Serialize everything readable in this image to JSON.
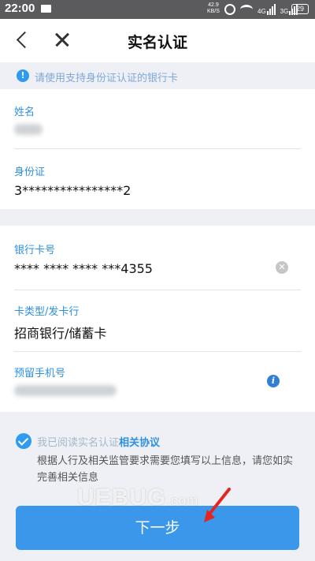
{
  "status_bar": {
    "time": "22:00",
    "net_speed": "42.9",
    "net_unit": "KB/S",
    "signal1_label": "4G",
    "signal2_label": "3G",
    "battery": "29"
  },
  "header": {
    "title": "实名认证"
  },
  "notice": {
    "icon": "!",
    "text": "请使用支持身份证认证的银行卡"
  },
  "identity": {
    "name_label": "姓名",
    "id_label": "身份证",
    "id_value": "3****************2"
  },
  "bank": {
    "card_label": "银行卡号",
    "card_value": "**** **** **** ***4355",
    "type_label": "卡类型/发卡行",
    "type_value": "招商银行/储蓄卡",
    "phone_label": "预留手机号"
  },
  "agreement": {
    "text": "我已阅读实名认证",
    "link": "相关协议",
    "note": "根据人行及相关监管要求需要您填写以上信息，请您如实完善相关信息"
  },
  "actions": {
    "next_label": "下一步"
  },
  "watermark": {
    "text": "UEBUG",
    "suffix": ".com"
  },
  "colors": {
    "accent": "#3a97ea",
    "label": "#2f8fe0",
    "background": "#eef0f5"
  }
}
